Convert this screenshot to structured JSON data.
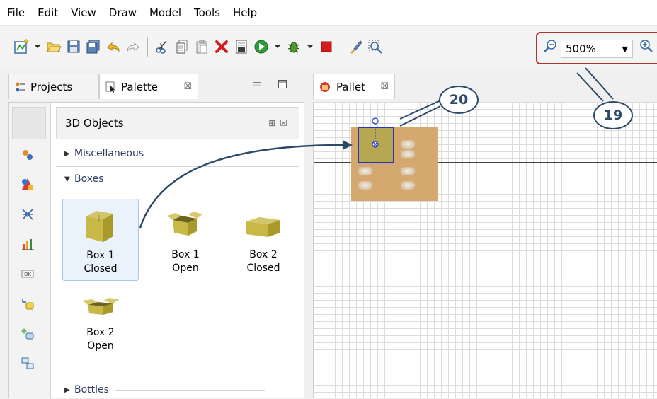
{
  "menu": [
    "File",
    "Edit",
    "View",
    "Draw",
    "Model",
    "Tools",
    "Help"
  ],
  "toolbar": {
    "zoom_value": "500%",
    "icons": [
      "new-model-icon",
      "open-icon",
      "save-icon",
      "save-all-icon",
      "undo-icon",
      "redo-icon",
      "cut-icon",
      "copy-icon",
      "paste-icon",
      "delete-icon",
      "build-icon",
      "run-icon",
      "debug-icon",
      "stop-icon",
      "brush-icon",
      "zoom-fit-icon",
      "zoom-out-icon",
      "zoom-in-icon"
    ]
  },
  "left_tabs": {
    "projects": "Projects",
    "palette": "Palette"
  },
  "palette": {
    "header": "3D Objects",
    "sections": {
      "miscellaneous": "Miscellaneous",
      "boxes": "Boxes",
      "bottles": "Bottles"
    },
    "items": [
      {
        "line1": "Box 1",
        "line2": "Closed"
      },
      {
        "line1": "Box 1",
        "line2": "Open"
      },
      {
        "line1": "Box 2",
        "line2": "Closed"
      },
      {
        "line1": "Box 2",
        "line2": "Open"
      }
    ]
  },
  "editor": {
    "tab_label": "Pallet"
  },
  "callouts": {
    "zoom": "19",
    "box": "20"
  },
  "colors": {
    "callout_stroke": "#2b4a6b",
    "zoom_highlight": "#b03434",
    "selection": "#2436c9",
    "pallet": "#d4a86e",
    "box": "#b5a850"
  }
}
